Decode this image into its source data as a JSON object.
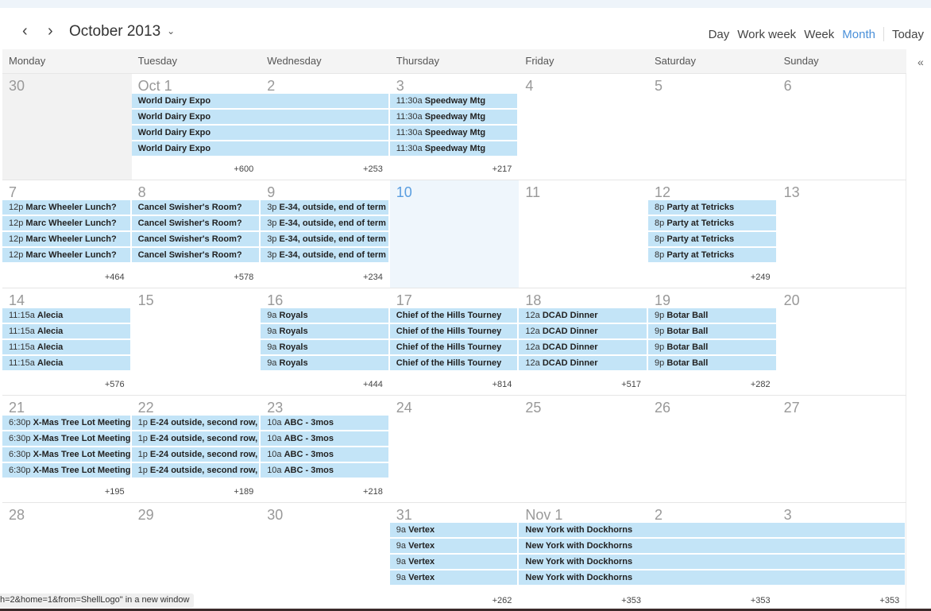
{
  "toolbar": {
    "prev_icon": "‹",
    "next_icon": "›",
    "month_title": "October 2013",
    "chevron_icon": "⌄",
    "views": [
      {
        "label": "Day",
        "active": false
      },
      {
        "label": "Work week",
        "active": false
      },
      {
        "label": "Week",
        "active": false
      },
      {
        "label": "Month",
        "active": true
      }
    ],
    "today_label": "Today",
    "collapse_icon": "«"
  },
  "weekdays": [
    "Monday",
    "Tuesday",
    "Wednesday",
    "Thursday",
    "Friday",
    "Saturday",
    "Sunday"
  ],
  "weeks": [
    {
      "days": [
        {
          "label": "30",
          "outside": true
        },
        {
          "label": "Oct 1"
        },
        {
          "label": "2"
        },
        {
          "label": "3"
        },
        {
          "label": "4"
        },
        {
          "label": "5"
        },
        {
          "label": "6"
        }
      ],
      "more": [
        {
          "col": 1,
          "text": "+600"
        },
        {
          "col": 2,
          "text": "+253"
        },
        {
          "col": 3,
          "text": "+217"
        }
      ],
      "events": [
        {
          "start": 1,
          "span": 2,
          "time": "",
          "title": "World Dairy Expo",
          "count": 4
        },
        {
          "start": 3,
          "span": 1,
          "time": "11:30a",
          "title": "Speedway Mtg",
          "count": 4
        }
      ]
    },
    {
      "days": [
        {
          "label": "7"
        },
        {
          "label": "8"
        },
        {
          "label": "9"
        },
        {
          "label": "10",
          "today": true
        },
        {
          "label": "11"
        },
        {
          "label": "12"
        },
        {
          "label": "13"
        }
      ],
      "more": [
        {
          "col": 0,
          "text": "+464"
        },
        {
          "col": 1,
          "text": "+578"
        },
        {
          "col": 2,
          "text": "+234"
        },
        {
          "col": 5,
          "text": "+249"
        }
      ],
      "events": [
        {
          "start": 0,
          "span": 1,
          "time": "12p",
          "title": "Marc Wheeler Lunch?",
          "count": 4
        },
        {
          "start": 1,
          "span": 1,
          "time": "",
          "title": "Cancel Swisher's Room?",
          "count": 4
        },
        {
          "start": 2,
          "span": 1,
          "time": "3p",
          "title": "E-34, outside, end of term",
          "count": 4
        },
        {
          "start": 5,
          "span": 1,
          "time": "8p",
          "title": "Party at Tetricks",
          "count": 4
        }
      ]
    },
    {
      "days": [
        {
          "label": "14"
        },
        {
          "label": "15"
        },
        {
          "label": "16"
        },
        {
          "label": "17"
        },
        {
          "label": "18"
        },
        {
          "label": "19"
        },
        {
          "label": "20"
        }
      ],
      "more": [
        {
          "col": 0,
          "text": "+576"
        },
        {
          "col": 2,
          "text": "+444"
        },
        {
          "col": 3,
          "text": "+814"
        },
        {
          "col": 4,
          "text": "+517"
        },
        {
          "col": 5,
          "text": "+282"
        }
      ],
      "events": [
        {
          "start": 0,
          "span": 1,
          "time": "11:15a",
          "title": "Alecia",
          "count": 4
        },
        {
          "start": 2,
          "span": 1,
          "time": "9a",
          "title": "Royals",
          "count": 4
        },
        {
          "start": 3,
          "span": 1,
          "time": "",
          "title": "Chief of the Hills Tourney",
          "count": 4
        },
        {
          "start": 4,
          "span": 1,
          "time": "12a",
          "title": "DCAD Dinner",
          "count": 4
        },
        {
          "start": 5,
          "span": 1,
          "time": "9p",
          "title": "Botar Ball",
          "count": 4
        }
      ]
    },
    {
      "days": [
        {
          "label": "21"
        },
        {
          "label": "22"
        },
        {
          "label": "23"
        },
        {
          "label": "24"
        },
        {
          "label": "25"
        },
        {
          "label": "26"
        },
        {
          "label": "27"
        }
      ],
      "more": [
        {
          "col": 0,
          "text": "+195"
        },
        {
          "col": 1,
          "text": "+189"
        },
        {
          "col": 2,
          "text": "+218"
        }
      ],
      "events": [
        {
          "start": 0,
          "span": 1,
          "time": "6:30p",
          "title": "X-Mas Tree Lot Meeting",
          "count": 4
        },
        {
          "start": 1,
          "span": 1,
          "time": "1p",
          "title": "E-24 outside, second row,",
          "count": 4
        },
        {
          "start": 2,
          "span": 1,
          "time": "10a",
          "title": "ABC - 3mos",
          "count": 4
        }
      ]
    },
    {
      "days": [
        {
          "label": "28"
        },
        {
          "label": "29"
        },
        {
          "label": "30"
        },
        {
          "label": "31"
        },
        {
          "label": "Nov 1"
        },
        {
          "label": "2"
        },
        {
          "label": "3"
        }
      ],
      "more": [
        {
          "col": 3,
          "text": "+262"
        },
        {
          "col": 4,
          "text": "+353"
        },
        {
          "col": 5,
          "text": "+353"
        },
        {
          "col": 6,
          "text": "+353"
        }
      ],
      "events": [
        {
          "start": 3,
          "span": 1,
          "time": "9a",
          "title": "Vertex",
          "count": 4
        },
        {
          "start": 4,
          "span": 3,
          "time": "",
          "title": "New York with Dockhorns",
          "count": 4
        }
      ]
    }
  ],
  "status_tooltip": "h=2&home=1&from=ShellLogo\" in a new window"
}
